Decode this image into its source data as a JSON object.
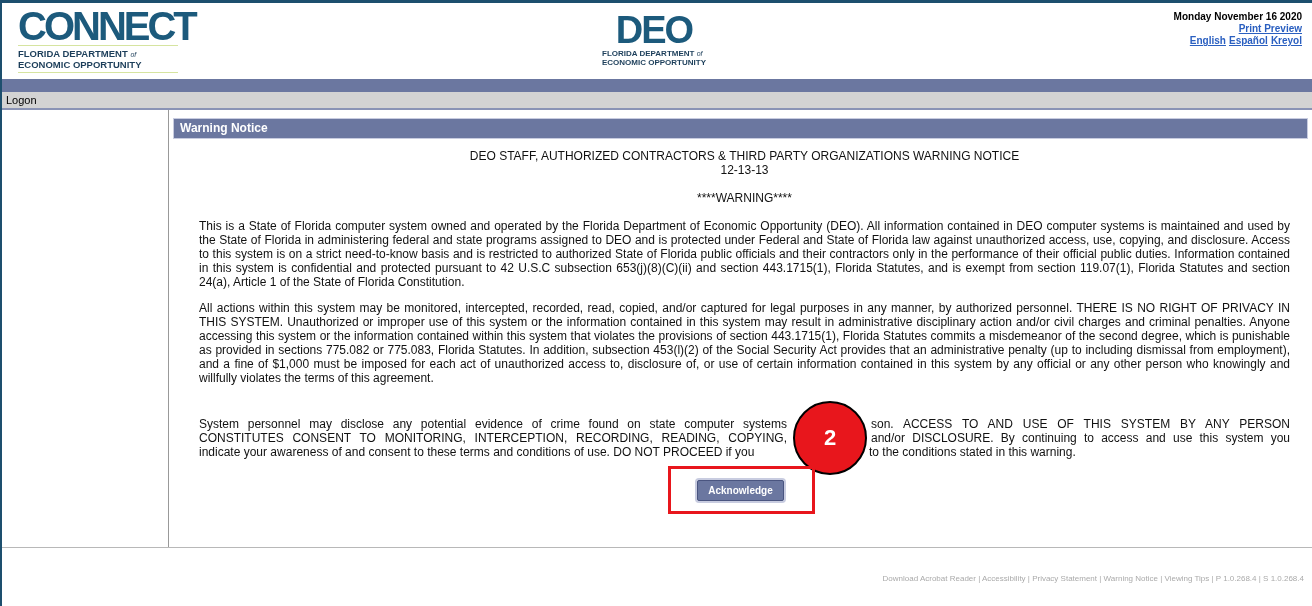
{
  "header": {
    "logo_left": {
      "wordmark": "CONNECT",
      "line_1": "FLORIDA DEPARTMENT",
      "line_1_small": "of",
      "line_2": "ECONOMIC OPPORTUNITY"
    },
    "logo_center": {
      "wordmark": "DEO",
      "line_1": "FLORIDA DEPARTMENT",
      "line_1_small": "of",
      "line_2": "ECONOMIC OPPORTUNITY"
    },
    "date": "Monday November 16 2020",
    "print_link": "Print Preview",
    "languages": [
      "English",
      "Español",
      "Kreyol"
    ]
  },
  "breadcrumb": "Logon",
  "panel": {
    "title": "Warning Notice",
    "heading_lines": [
      "DEO STAFF, AUTHORIZED CONTRACTORS & THIRD PARTY ORGANIZATIONS WARNING NOTICE",
      "12-13-13"
    ],
    "warning": "****WARNING****",
    "paragraphs": [
      "This is a State of Florida computer system owned and operated by the Florida Department of Economic Opportunity (DEO). All information contained in DEO computer systems is maintained and used by the State of Florida in administering federal and state programs assigned to DEO and is protected under Federal and State of Florida law against unauthorized access, use, copying, and disclosure. Access to this system is on a strict need-to-know basis and is restricted to authorized State of Florida public officials and their contractors only in the performance of their official public duties. Information contained in this system is confidential and protected pursuant to 42 U.S.C subsection 653(j)(8)(C)(ii) and section 443.1715(1), Florida Statutes, and is exempt from section 119.07(1), Florida Statutes and section 24(a), Article 1 of the State of Florida Constitution.",
      "All actions within this system may be monitored, intercepted, recorded, read, copied, and/or captured for legal purposes in any manner, by authorized personnel. THERE IS NO RIGHT OF PRIVACY IN THIS SYSTEM. Unauthorized or improper use of this system or the information contained in this system may result in administrative disciplinary action and/or civil charges and criminal penalties. Anyone accessing this system or the information contained within this system that violates the provisions of section 443.1715(1), Florida Statutes commits a misdemeanor of the second degree, which is punishable as provided in sections 775.082 or 775.083, Florida Statutes. In addition, subsection 453(l)(2) of the Social Security Act provides that an administrative penalty (up to including dismissal from employment), and a fine of $1,000 must be imposed for each act of unauthorized access to, disclosure of, or use of certain information contained in this system by any official or any other person who knowingly and willfully violates the terms of this agreement."
    ],
    "covered_paragraph": [
      {
        "left": "System personnel may disclose any potential evidence of crime found on state computer systems",
        "right": "son. ACCESS TO AND USE OF THIS SYSTEM BY ANY PERSON",
        "last": false
      },
      {
        "left": "CONSTITUTES CONSENT TO MONITORING, INTERCEPTION, RECORDING, READING, COPYING,",
        "right": "and/or DISCLOSURE. By continuing to access and use this system you",
        "last": false
      },
      {
        "left": "indicate your awareness of and consent to these terms and conditions of use. DO NOT PROCEED if you",
        "right": "to the conditions stated in this warning.",
        "last": true
      }
    ],
    "button": "Acknowledge",
    "callout": "2"
  },
  "footer": "Download Acrobat Reader | Accessibility | Privacy Statement | Warning Notice | Viewing Tips | P 1.0.268.4 | S 1.0.268.4"
}
